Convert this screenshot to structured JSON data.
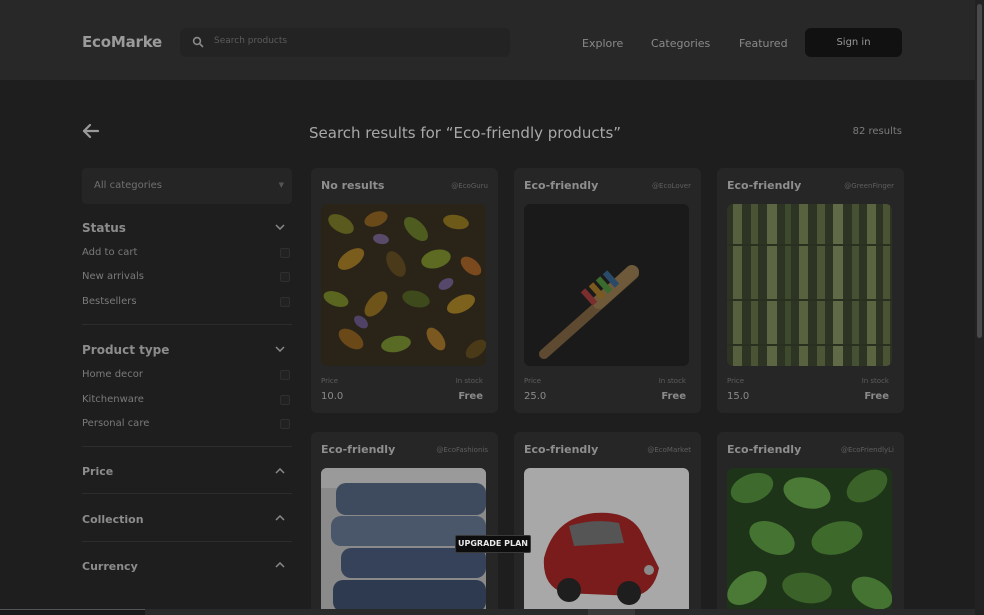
{
  "header": {
    "logo": "EcoMarke",
    "search_placeholder": "Search products",
    "nav": [
      "Explore",
      "Categories",
      "Featured"
    ],
    "signin_label": "Sign in"
  },
  "sidebar": {
    "category_select": "All categories",
    "status": {
      "title": "Status",
      "options": [
        "Add to cart",
        "New arrivals",
        "Bestsellers"
      ]
    },
    "product_type": {
      "title": "Product type",
      "options": [
        "Home decor",
        "Kitchenware",
        "Personal care"
      ]
    },
    "price": {
      "title": "Price"
    },
    "collection": {
      "title": "Collection"
    },
    "currency": {
      "title": "Currency"
    }
  },
  "results": {
    "title": "Search results for “Eco-friendly products”",
    "count": "82 results"
  },
  "cards": [
    {
      "title": "No results",
      "user": "@EcoGuru",
      "price_label": "Price",
      "stock": "In stock",
      "price": "10.0",
      "shipping": "Free",
      "image": "autumn-leaves"
    },
    {
      "title": "Eco-friendly",
      "user": "@EcoLover",
      "price_label": "Price",
      "stock": "In stock",
      "price": "25.0",
      "shipping": "Free",
      "image": "bamboo-toothbrush"
    },
    {
      "title": "Eco-friendly",
      "user": "@GreenFinger",
      "price_label": "Price",
      "stock": "In stock",
      "price": "15.0",
      "shipping": "Free",
      "image": "bamboo-forest"
    },
    {
      "title": "Eco-friendly",
      "user": "@EcoFashionis",
      "image": "folded-jeans"
    },
    {
      "title": "Eco-friendly",
      "user": "@EcoMarket",
      "image": "red-toy-car"
    },
    {
      "title": "Eco-friendly",
      "user": "@EcoFriendlyLi",
      "image": "mint-leaves"
    }
  ],
  "tooltip": "UPGRADE PLAN",
  "colors": {
    "background": "#1e1e1e",
    "header": "#282828",
    "card": "#262626",
    "button": "#111111"
  }
}
